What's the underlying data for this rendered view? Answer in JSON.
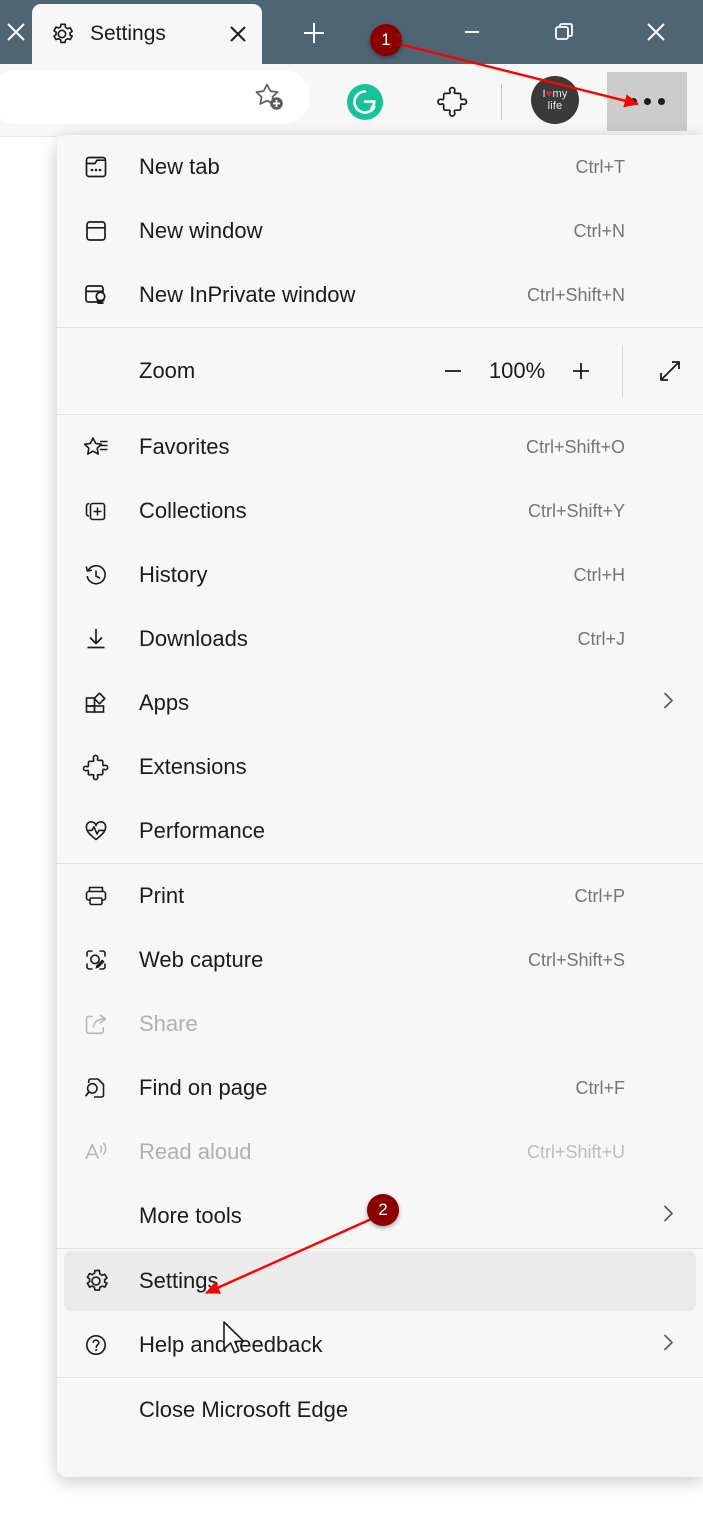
{
  "window": {
    "tab": {
      "title": "Settings",
      "icon": "gear-icon",
      "close_icon": "close-icon"
    },
    "left_tab_close_icon": "close-icon",
    "new_tab_icon": "plus-icon",
    "controls": {
      "minimize_icon": "minimize-icon",
      "restore_icon": "restore-icon",
      "close_icon": "close-icon"
    }
  },
  "toolbar": {
    "address_value": "",
    "address_placeholder": "",
    "favorite_icon": "add-favorite-star-icon",
    "grammarly_label": "G",
    "grammarly_color": "#15c39a",
    "extensions_icon": "puzzle-piece-icon",
    "avatar": {
      "line1_pre": "I ",
      "heart": "♥",
      "line1_post": " my",
      "line2": "life"
    },
    "more_icon": "ellipsis-icon"
  },
  "menu": {
    "groups": [
      {
        "items": [
          {
            "label": "New tab",
            "accel": "Ctrl+T",
            "icon": "new-tab-icon",
            "disabled": false,
            "chevron": false
          },
          {
            "label": "New window",
            "accel": "Ctrl+N",
            "icon": "new-window-icon",
            "disabled": false,
            "chevron": false
          },
          {
            "label": "New InPrivate window",
            "accel": "Ctrl+Shift+N",
            "icon": "inprivate-window-icon",
            "disabled": false,
            "chevron": false
          }
        ]
      },
      {
        "zoom": {
          "label": "Zoom",
          "value": "100%",
          "minus_icon": "minus-icon",
          "plus_icon": "plus-icon",
          "fullscreen_icon": "fullscreen-arrows-icon"
        }
      },
      {
        "items": [
          {
            "label": "Favorites",
            "accel": "Ctrl+Shift+O",
            "icon": "favorites-star-icon",
            "disabled": false,
            "chevron": false
          },
          {
            "label": "Collections",
            "accel": "Ctrl+Shift+Y",
            "icon": "collections-icon",
            "disabled": false,
            "chevron": false
          },
          {
            "label": "History",
            "accel": "Ctrl+H",
            "icon": "history-clock-icon",
            "disabled": false,
            "chevron": false
          },
          {
            "label": "Downloads",
            "accel": "Ctrl+J",
            "icon": "downloads-arrow-icon",
            "disabled": false,
            "chevron": false
          },
          {
            "label": "Apps",
            "accel": "",
            "icon": "apps-grid-icon",
            "disabled": false,
            "chevron": true
          },
          {
            "label": "Extensions",
            "accel": "",
            "icon": "puzzle-piece-icon",
            "disabled": false,
            "chevron": false
          },
          {
            "label": "Performance",
            "accel": "",
            "icon": "performance-pulse-icon",
            "disabled": false,
            "chevron": false
          }
        ]
      },
      {
        "items": [
          {
            "label": "Print",
            "accel": "Ctrl+P",
            "icon": "printer-icon",
            "disabled": false,
            "chevron": false
          },
          {
            "label": "Web capture",
            "accel": "Ctrl+Shift+S",
            "icon": "web-capture-icon",
            "disabled": false,
            "chevron": false
          },
          {
            "label": "Share",
            "accel": "",
            "icon": "share-icon",
            "disabled": true,
            "chevron": false
          },
          {
            "label": "Find on page",
            "accel": "Ctrl+F",
            "icon": "find-on-page-icon",
            "disabled": false,
            "chevron": false
          },
          {
            "label": "Read aloud",
            "accel": "Ctrl+Shift+U",
            "icon": "read-aloud-icon",
            "disabled": true,
            "chevron": false
          },
          {
            "label": "More tools",
            "accel": "",
            "icon": "",
            "disabled": false,
            "chevron": true
          }
        ]
      },
      {
        "items": [
          {
            "label": "Settings",
            "accel": "",
            "icon": "gear-icon",
            "disabled": false,
            "chevron": false,
            "highlighted": true
          },
          {
            "label": "Help and feedback",
            "accel": "",
            "icon": "help-circle-icon",
            "disabled": false,
            "chevron": true
          }
        ]
      },
      {
        "items": [
          {
            "label": "Close Microsoft Edge",
            "accel": "",
            "icon": "",
            "disabled": false,
            "chevron": false
          }
        ]
      }
    ]
  },
  "annotations": {
    "accent_color": "#8b0000",
    "arrow_color": "#ff0000",
    "badges": [
      {
        "label": "1"
      },
      {
        "label": "2"
      }
    ]
  }
}
